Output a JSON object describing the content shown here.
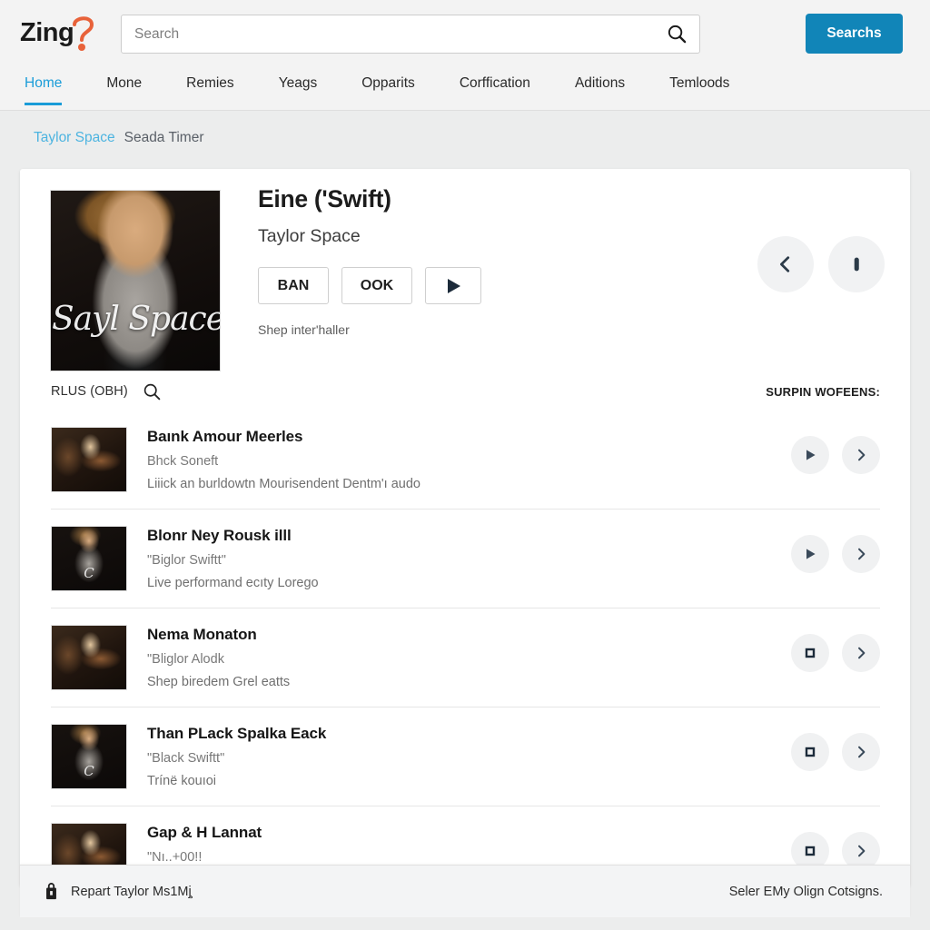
{
  "header": {
    "logo_text": "Zing",
    "logo_icon": "question-swoosh-icon",
    "search_placeholder": "Search",
    "search_value": "",
    "search_icon": "search-icon",
    "search_button_label": "Searchs",
    "accent_color": "#1185b8"
  },
  "nav": {
    "items": [
      {
        "label": "Home",
        "active": true
      },
      {
        "label": "Mone",
        "active": false
      },
      {
        "label": "Remies",
        "active": false
      },
      {
        "label": "Yeags",
        "active": false
      },
      {
        "label": "Opparits",
        "active": false
      },
      {
        "label": "Corffication",
        "active": false
      },
      {
        "label": "Aditions",
        "active": false
      },
      {
        "label": "Temloods",
        "active": false
      }
    ],
    "active_color": "#1a9cd8"
  },
  "breadcrumb": {
    "link": "Taylor Space",
    "current": "Seada Timer"
  },
  "hero": {
    "thumbnail_script_text": "Sayl Space",
    "title": "Eine ('Swift)",
    "subtitle": "Taylor Space",
    "buttons": [
      {
        "label": "BAN",
        "icon": ""
      },
      {
        "label": "OOK",
        "icon": ""
      },
      {
        "label": "",
        "icon": "play-icon"
      }
    ],
    "note": "Shep inter'haller",
    "circle_buttons": [
      {
        "icon": "chevron-left-icon"
      },
      {
        "icon": "pause-bar-icon"
      }
    ]
  },
  "list_header": {
    "label": "RLUS (OBH)",
    "search_icon": "search-icon",
    "right_label": "SURPIN WOFEENS:"
  },
  "list": {
    "rows": [
      {
        "title": "Baınk Amour Meerles",
        "subtitle": "Bhck Soneft",
        "description": "Liiick an burldowtn Mourisendent Dentm'ı audo",
        "thumb_type": "guitar",
        "thumb_script": "",
        "primary_icon": "play-icon",
        "secondary_icon": "chevron-right-icon"
      },
      {
        "title": "Blonr Ney Rousk illl",
        "subtitle": "\"Biglor Swiftt\"",
        "description": "Live performand ecıty Lorego",
        "thumb_type": "portrait",
        "thumb_script": "C",
        "primary_icon": "play-icon",
        "secondary_icon": "chevron-right-icon"
      },
      {
        "title": "Nema Monaton",
        "subtitle": "\"Bliglor Alodk",
        "description": "Shep biredem Grel eatts",
        "thumb_type": "guitar",
        "thumb_script": "",
        "primary_icon": "stop-icon",
        "secondary_icon": "chevron-right-icon"
      },
      {
        "title": "Than PLack Spalka Eack",
        "subtitle": "\"Black Swiftt\"",
        "description": "Trínë kouıoi",
        "thumb_type": "portrait",
        "thumb_script": "C",
        "primary_icon": "stop-icon",
        "secondary_icon": "chevron-right-icon"
      },
      {
        "title": "Gap & H Lannat",
        "subtitle": "\"Nı..+00!!",
        "description": "",
        "thumb_type": "guitar",
        "thumb_script": "",
        "primary_icon": "stop-icon",
        "secondary_icon": "chevron-right-icon"
      }
    ]
  },
  "footer": {
    "icon": "briefcase-icon",
    "left_text": "Repart Taylor Ms1Mj̧",
    "right_text": "Seler EMy Olign Cotsigns."
  }
}
